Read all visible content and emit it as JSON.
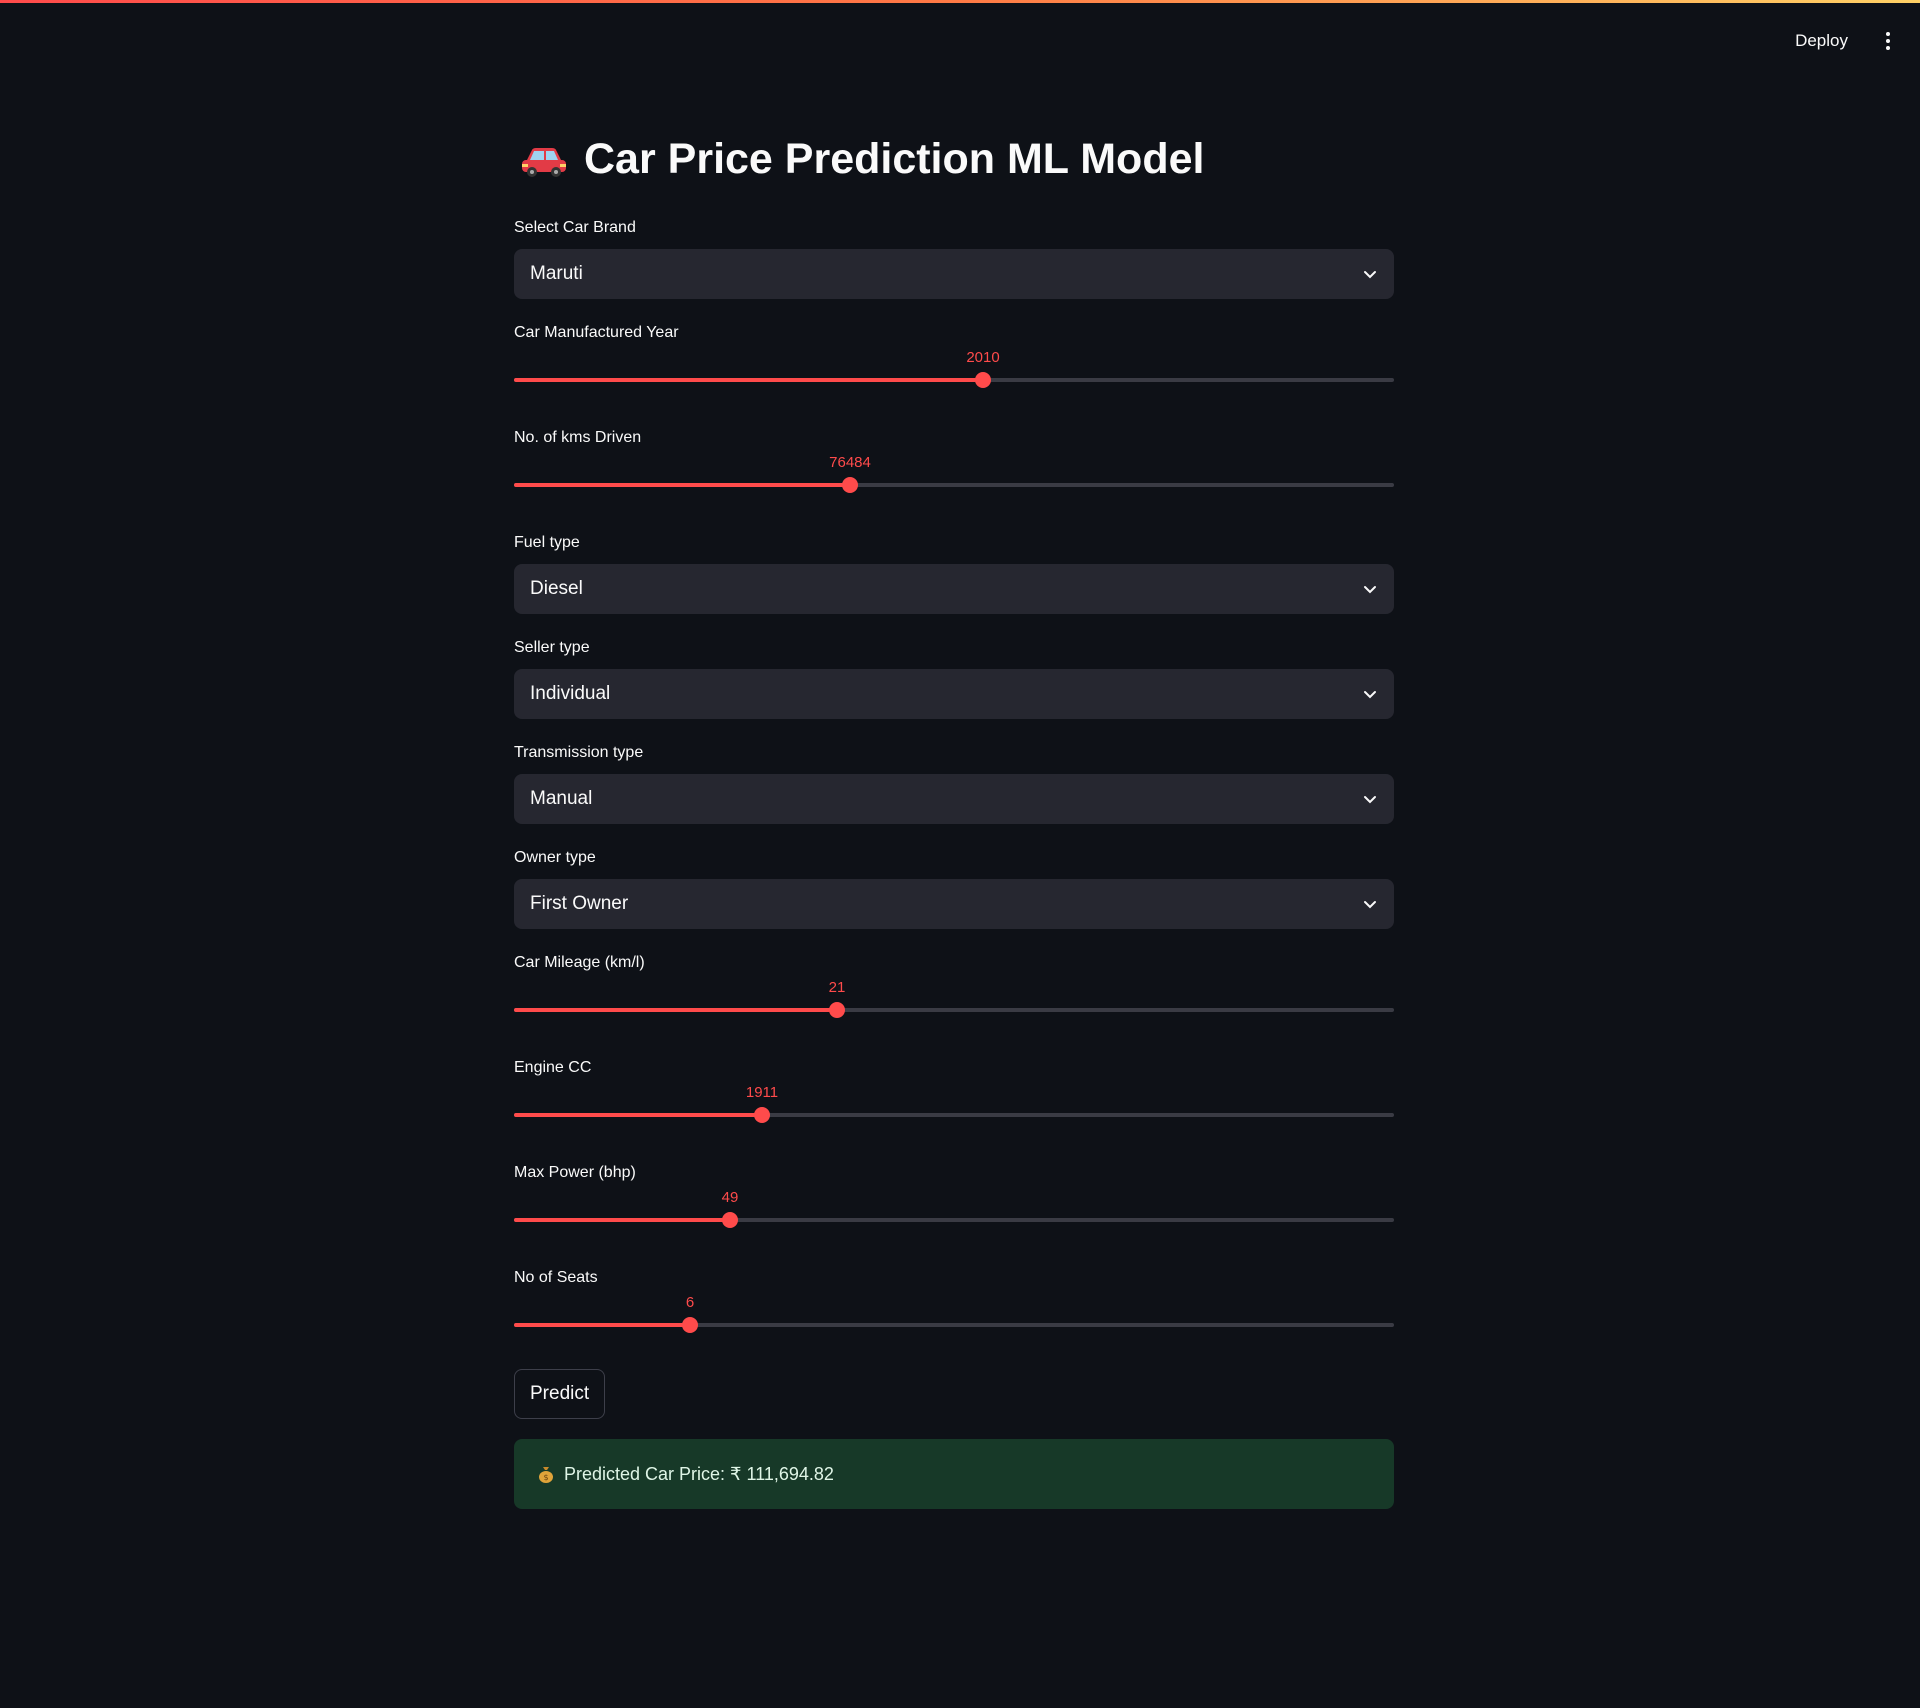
{
  "header": {
    "deploy_label": "Deploy"
  },
  "page": {
    "title": "Car Price Prediction ML Model",
    "title_icon": "car-icon"
  },
  "fields": {
    "brand": {
      "label": "Select Car Brand",
      "value": "Maruti"
    },
    "year": {
      "label": "Car Manufactured Year",
      "value": "2010",
      "fraction": 0.533
    },
    "kms": {
      "label": "No. of kms Driven",
      "value": "76484",
      "fraction": 0.382
    },
    "fuel": {
      "label": "Fuel type",
      "value": "Diesel"
    },
    "seller": {
      "label": "Seller type",
      "value": "Individual"
    },
    "transmission": {
      "label": "Transmission type",
      "value": "Manual"
    },
    "owner": {
      "label": "Owner type",
      "value": "First Owner"
    },
    "mileage": {
      "label": "Car Mileage (km/l)",
      "value": "21",
      "fraction": 0.367
    },
    "engine": {
      "label": "Engine CC",
      "value": "1911",
      "fraction": 0.282
    },
    "power": {
      "label": "Max Power (bhp)",
      "value": "49",
      "fraction": 0.245
    },
    "seats": {
      "label": "No of Seats",
      "value": "6",
      "fraction": 0.2
    }
  },
  "actions": {
    "predict_label": "Predict"
  },
  "result": {
    "icon": "money-bag-icon",
    "text": "Predicted Car Price: ₹ 111,694.82"
  },
  "colors": {
    "accent": "#ff4b4b",
    "background": "#0e1117",
    "input_bg": "#262730",
    "success_bg": "#173928"
  }
}
